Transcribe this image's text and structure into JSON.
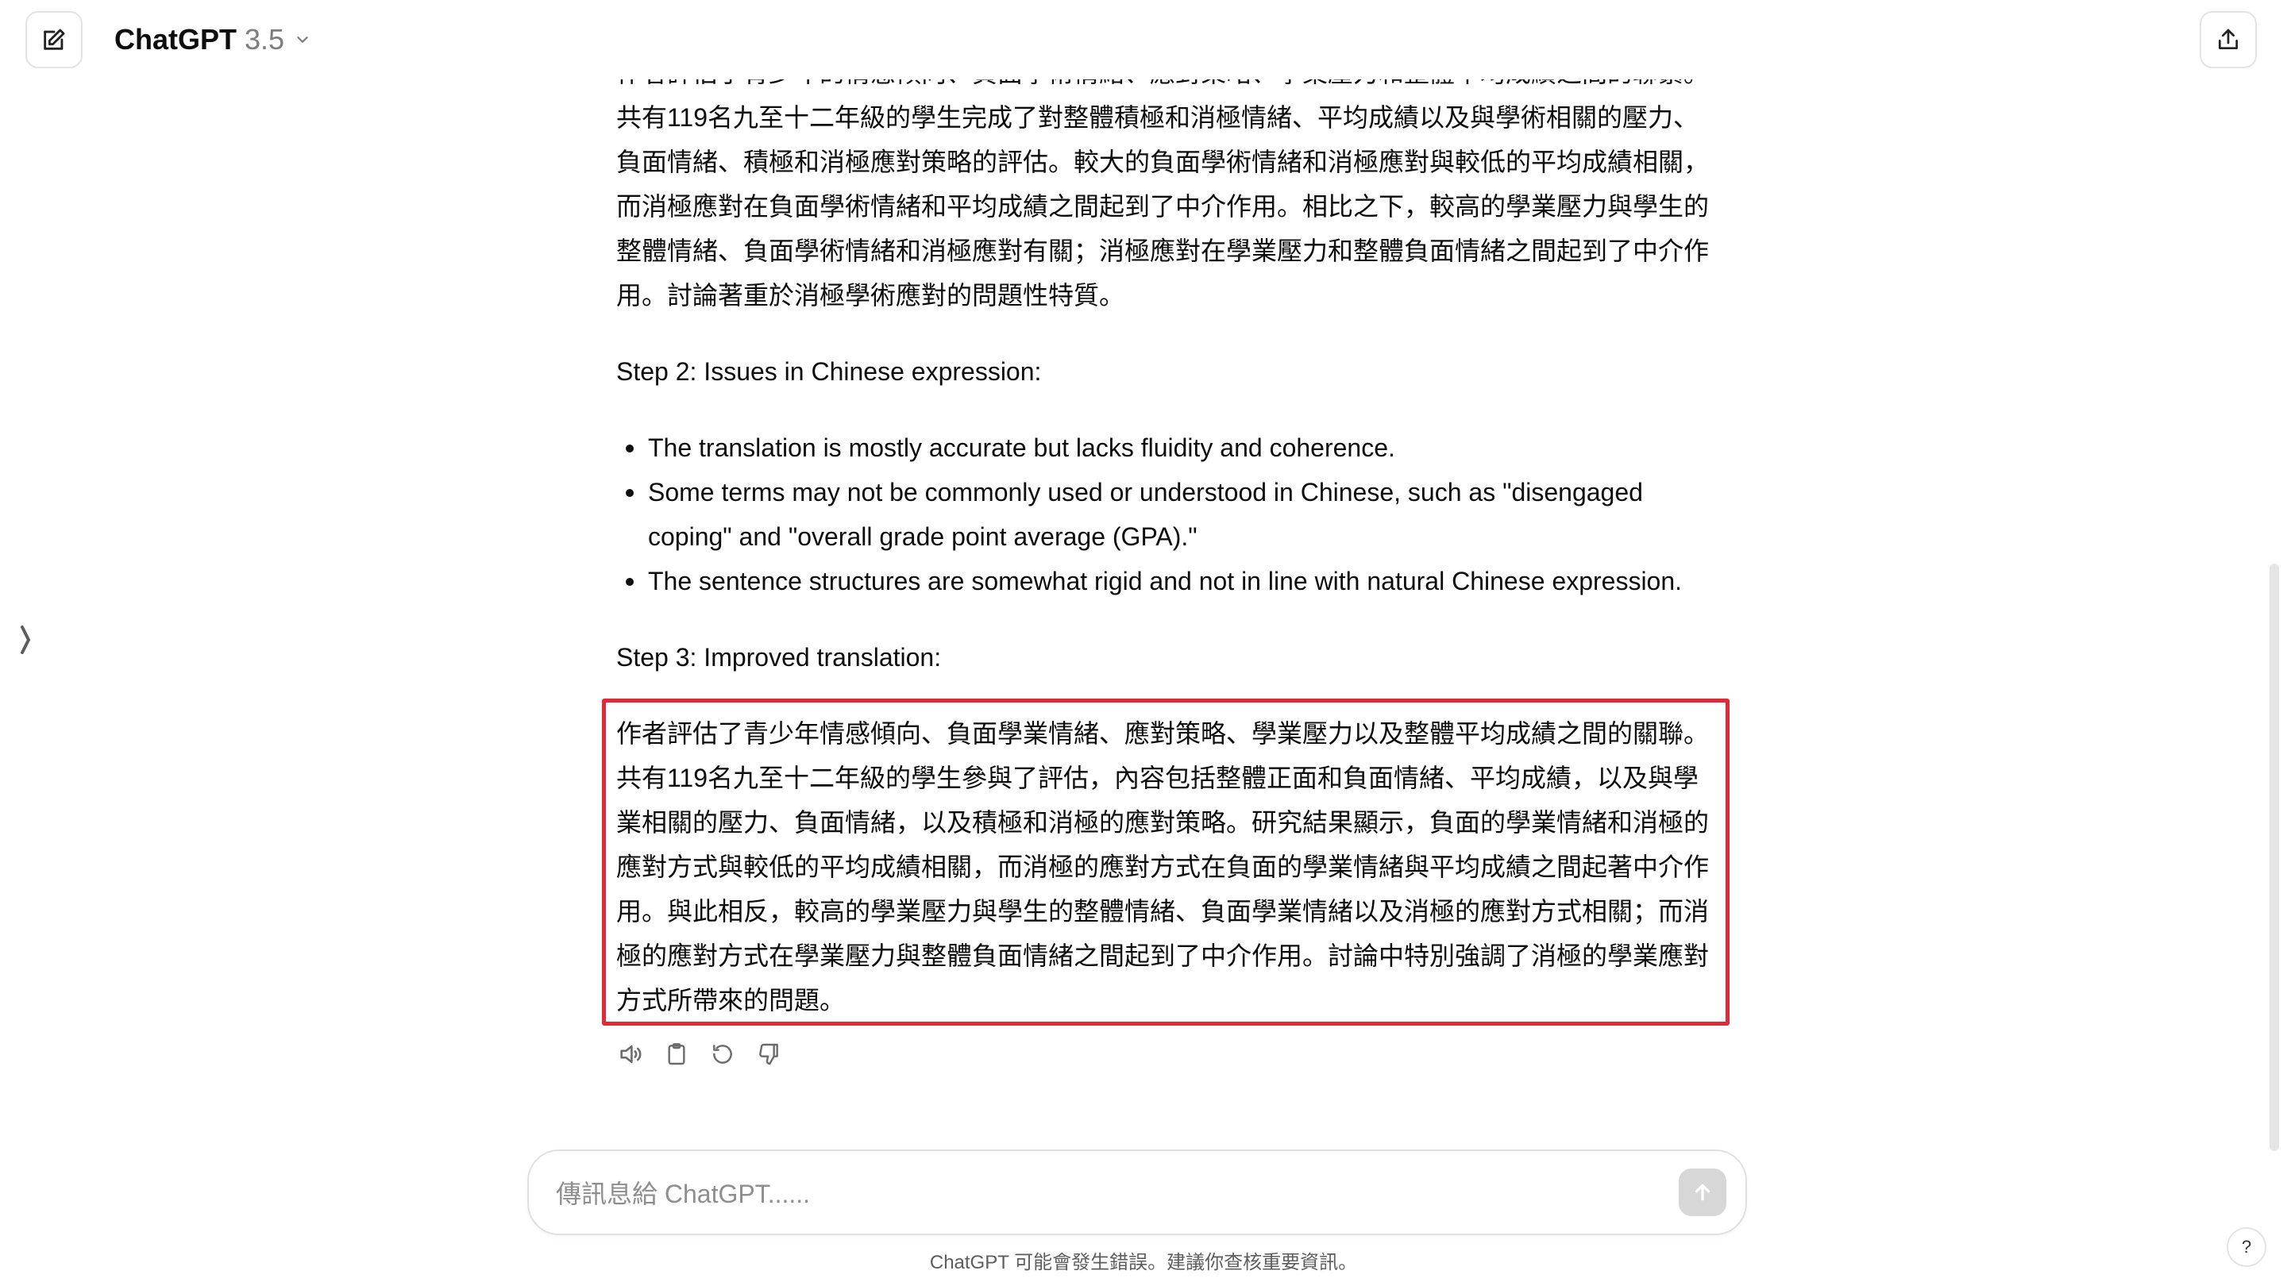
{
  "header": {
    "model_name": "ChatGPT",
    "model_version": "3.5"
  },
  "message": {
    "clipped_top_line": "作者評估了青少年的情感傾向、負面學術情緒、應對策略、學業壓力和整體平均成績之間的聯繫。",
    "first_translation": "共有119名九至十二年級的學生完成了對整體積極和消極情緒、平均成績以及與學術相關的壓力、負面情緒、積極和消極應對策略的評估。較大的負面學術情緒和消極應對與較低的平均成績相關，而消極應對在負面學術情緒和平均成績之間起到了中介作用。相比之下，較高的學業壓力與學生的整體情緒、負面學術情緒和消極應對有關；消極應對在學業壓力和整體負面情緒之間起到了中介作用。討論著重於消極學術應對的問題性特質。",
    "step2_heading": "Step 2: Issues in Chinese expression:",
    "step2_bullets": [
      "The translation is mostly accurate but lacks fluidity and coherence.",
      "Some terms may not be commonly used or understood in Chinese, such as \"disengaged coping\" and \"overall grade point average (GPA).\"",
      "The sentence structures are somewhat rigid and not in line with natural Chinese expression."
    ],
    "step3_heading": "Step 3: Improved translation:",
    "improved_translation": "作者評估了青少年情感傾向、負面學業情緒、應對策略、學業壓力以及整體平均成績之間的關聯。共有119名九至十二年級的學生參與了評估，內容包括整體正面和負面情緒、平均成績，以及與學業相關的壓力、負面情緒，以及積極和消極的應對策略。研究結果顯示，負面的學業情緒和消極的應對方式與較低的平均成績相關，而消極的應對方式在負面的學業情緒與平均成績之間起著中介作用。與此相反，較高的學業壓力與學生的整體情緒、負面學業情緒以及消極的應對方式相關；而消極的應對方式在學業壓力與整體負面情緒之間起到了中介作用。討論中特別強調了消極的學業應對方式所帶來的問題。"
  },
  "composer": {
    "placeholder": "傳訊息給 ChatGPT......"
  },
  "footer": {
    "disclaimer": "ChatGPT 可能會發生錯誤。建議你查核重要資訊。",
    "help_label": "?"
  },
  "colors": {
    "highlight_border": "#e3283a",
    "muted_text": "#7d7d7d"
  }
}
